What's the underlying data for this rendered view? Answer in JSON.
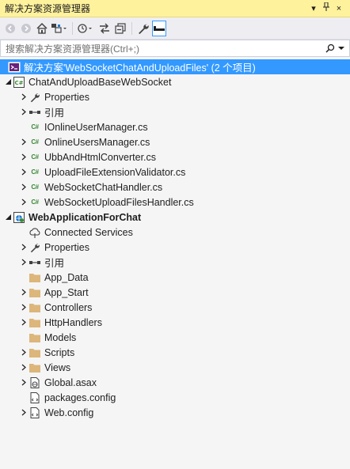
{
  "window": {
    "title": "解决方案资源管理器",
    "pin_glyph": "▾",
    "autohide_glyph": "ꟷ",
    "close_glyph": "×"
  },
  "search": {
    "placeholder": "搜索解决方案资源管理器(Ctrl+;)",
    "icon": "search-icon"
  },
  "tree": {
    "solution": "解决方案'WebSocketChatAndUploadFiles' (2 个项目)",
    "project1": {
      "name": "ChatAndUploadBaseWebSocket",
      "properties": "Properties",
      "references": "引用",
      "files": [
        "IOnlineUserManager.cs",
        "OnlineUsersManager.cs",
        "UbbAndHtmlConverter.cs",
        "UploadFileExtensionValidator.cs",
        "WebSocketChatHandler.cs",
        "WebSocketUploadFilesHandler.cs"
      ]
    },
    "project2": {
      "name": "WebApplicationForChat",
      "connected": "Connected Services",
      "properties": "Properties",
      "references": "引用",
      "folders": [
        "App_Data",
        "App_Start",
        "Controllers",
        "HttpHandlers",
        "Models",
        "Scripts",
        "Views"
      ],
      "global": "Global.asax",
      "packages": "packages.config",
      "webconfig": "Web.config"
    }
  },
  "colors": {
    "title_bg": "#fff29d",
    "selection": "#3399ff",
    "folder": "#dcb67a",
    "cs_green": "#388a34"
  }
}
